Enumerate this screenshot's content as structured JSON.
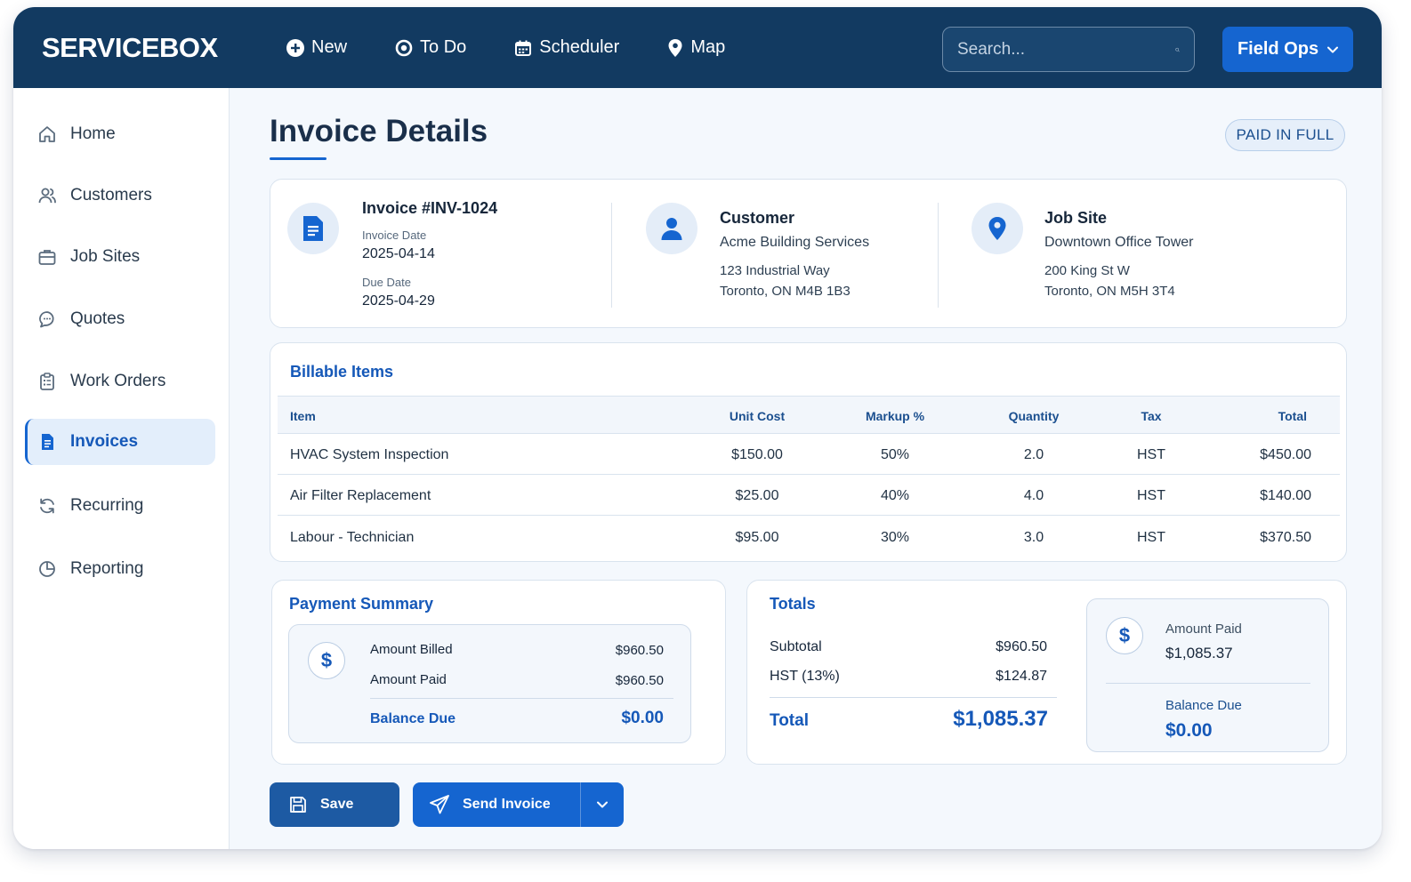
{
  "brand": "SERVICEBOX",
  "nav": [
    {
      "label": "New",
      "icon": "plus-circle-icon"
    },
    {
      "label": "To Do",
      "icon": "todo-icon"
    },
    {
      "label": "Scheduler",
      "icon": "calendar-icon"
    },
    {
      "label": "Map",
      "icon": "map-pin-icon"
    }
  ],
  "search": {
    "placeholder": "Search..."
  },
  "account_menu": {
    "label": "Field Ops"
  },
  "sidebar": {
    "items": [
      {
        "label": "Home",
        "icon": "home-icon"
      },
      {
        "label": "Customers",
        "icon": "users-icon"
      },
      {
        "label": "Job Sites",
        "icon": "briefcase-icon"
      },
      {
        "label": "Quotes",
        "icon": "chat-icon"
      },
      {
        "label": "Work Orders",
        "icon": "clipboard-icon"
      },
      {
        "label": "Invoices",
        "icon": "document-icon",
        "active": true
      },
      {
        "label": "Recurring",
        "icon": "refresh-icon"
      },
      {
        "label": "Reporting",
        "icon": "pie-chart-icon"
      }
    ]
  },
  "page": {
    "title": "Invoice Details",
    "status_badge": "PAID IN FULL"
  },
  "invoice": {
    "number": "Invoice #INV-1024",
    "invoice_date_label": "Invoice Date",
    "invoice_date": "2025-04-14",
    "due_date_label": "Due Date",
    "due_date": "2025-04-29"
  },
  "customer": {
    "heading": "Customer",
    "name": "Acme Building Services",
    "address_line1": "123 Industrial Way",
    "address_line2": "Toronto, ON  M4B 1B3"
  },
  "job_site": {
    "heading": "Job Site",
    "name": "Downtown Office Tower",
    "address_line1": "200 King St W",
    "address_line2": "Toronto, ON  M5H 3T4"
  },
  "billable": {
    "title": "Billable Items",
    "columns": [
      "Item",
      "Unit Cost",
      "Markup %",
      "Quantity",
      "Tax",
      "Total"
    ],
    "rows": [
      [
        "HVAC System Inspection",
        "$150.00",
        "50%",
        "2.0",
        "HST",
        "$450.00"
      ],
      [
        "Air Filter Replacement",
        "$25.00",
        "40%",
        "4.0",
        "HST",
        "$140.00"
      ],
      [
        "Labour - Technician",
        "$95.00",
        "30%",
        "3.0",
        "HST",
        "$370.50"
      ]
    ]
  },
  "payment_summary": {
    "title": "Payment Summary",
    "amount_billed_label": "Amount Billed",
    "amount_billed": "$960.50",
    "amount_paid_label": "Amount Paid",
    "amount_paid": "$960.50",
    "balance_due_label": "Balance Due",
    "balance_due": "$0.00",
    "icon": "dollar-icon"
  },
  "totals": {
    "title": "Totals",
    "subtotal_label": "Subtotal",
    "subtotal": "$960.50",
    "tax_label": "HST (13%)",
    "tax": "$124.87",
    "total_label": "Total",
    "total": "$1,085.37",
    "amount_paid_label": "Amount Paid",
    "amount_paid": "$1,085.37",
    "balance_due_label": "Balance Due",
    "balance_due": "$0.00",
    "icon": "dollar-icon"
  },
  "actions": {
    "save": "Save",
    "send": "Send Invoice"
  },
  "colors": {
    "topbar": "#123a61",
    "accent": "#1565d0",
    "active_bg": "#e3eefb"
  }
}
